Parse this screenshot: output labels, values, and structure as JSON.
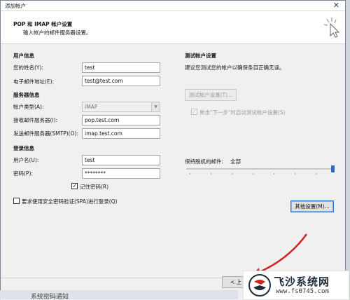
{
  "window": {
    "title": "添加帐户",
    "close_glyph": "✕"
  },
  "header": {
    "title": "POP 和 IMAP 帐户设置",
    "subtitle": "输入帐户的邮件服务器设置。"
  },
  "user_info": {
    "section": "用户信息",
    "name_label": "您的姓名(Y):",
    "name_value": "test",
    "email_label": "电子邮件地址(E):",
    "email_value": "test@test.com"
  },
  "server_info": {
    "section": "服务器信息",
    "type_label": "帐户类型(A):",
    "type_value": "IMAP",
    "incoming_label": "接收邮件服务器(I):",
    "incoming_value": "pop.test.com",
    "outgoing_label": "发送邮件服务器(SMTP)(O):",
    "outgoing_value": "imap.test.com"
  },
  "login_info": {
    "section": "登录信息",
    "username_label": "用户名(U):",
    "username_value": "test",
    "password_label": "密码(P):",
    "password_value": "********",
    "remember_label": "记住密码(R)",
    "remember_checked": true
  },
  "spa": {
    "label": "要求使用安全密码验证(SPA)进行登录(Q)",
    "checked": false
  },
  "test_settings": {
    "section": "测试帐户设置",
    "description": "建议您测试您的帐户以确保条目正确无误。",
    "test_button": "测试帐户设置(T)...",
    "auto_test_label": "单击\"下一步\"时自动测试帐户设置(S)",
    "auto_test_checked": true
  },
  "offline": {
    "label": "保持脱机的邮件:",
    "value": "全部",
    "slider_level": 1.0
  },
  "more_settings_button": "其他设置(M)...",
  "footer": {
    "back_button": "< 上"
  },
  "watermark": {
    "title": "飞沙系统网",
    "url": "www.fs0745.com"
  },
  "background_text": "系统密码通知"
}
